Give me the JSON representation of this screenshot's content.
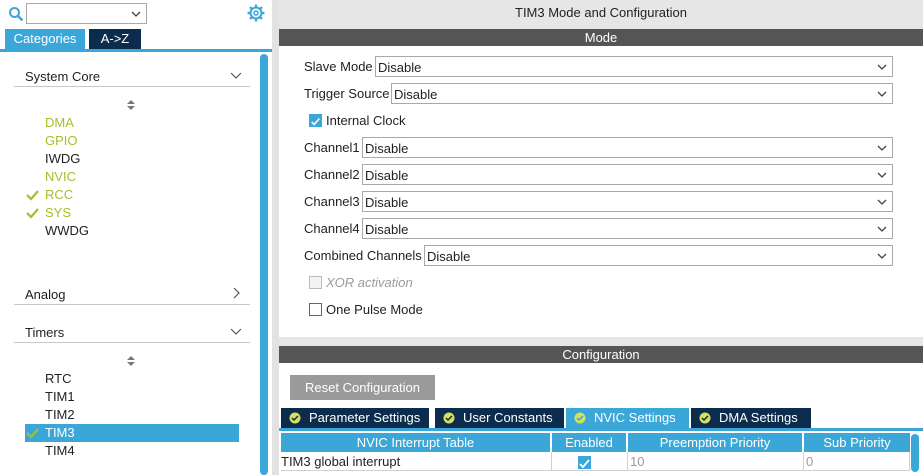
{
  "left_panel": {
    "tabs": {
      "categories": "Categories",
      "az": "A->Z"
    },
    "sections": {
      "system_core": {
        "title": "System Core",
        "items": [
          {
            "label": "DMA",
            "color": "#a7be2a",
            "checked": false
          },
          {
            "label": "GPIO",
            "color": "#a7be2a",
            "checked": false
          },
          {
            "label": "IWDG",
            "color": "#222222",
            "checked": false
          },
          {
            "label": "NVIC",
            "color": "#a7be2a",
            "checked": false
          },
          {
            "label": "RCC",
            "color": "#a7be2a",
            "checked": true
          },
          {
            "label": "SYS",
            "color": "#a7be2a",
            "checked": true
          },
          {
            "label": "WWDG",
            "color": "#222222",
            "checked": false
          }
        ]
      },
      "analog": {
        "title": "Analog"
      },
      "timers": {
        "title": "Timers",
        "items": [
          {
            "label": "RTC",
            "checked": false,
            "selected": false
          },
          {
            "label": "TIM1",
            "checked": false,
            "selected": false
          },
          {
            "label": "TIM2",
            "checked": false,
            "selected": false
          },
          {
            "label": "TIM3",
            "checked": true,
            "selected": true
          },
          {
            "label": "TIM4",
            "checked": false,
            "selected": false
          }
        ]
      }
    }
  },
  "right_panel": {
    "title": "TIM3 Mode and Configuration",
    "mode": {
      "header": "Mode",
      "slave_mode": {
        "label": "Slave Mode",
        "value": "Disable"
      },
      "trigger_source": {
        "label": "Trigger Source",
        "value": "Disable"
      },
      "internal_clock": {
        "label": "Internal Clock",
        "checked": true
      },
      "channel1": {
        "label": "Channel1",
        "value": "Disable"
      },
      "channel2": {
        "label": "Channel2",
        "value": "Disable"
      },
      "channel3": {
        "label": "Channel3",
        "value": "Disable"
      },
      "channel4": {
        "label": "Channel4",
        "value": "Disable"
      },
      "combined_channels": {
        "label": "Combined Channels",
        "value": "Disable"
      },
      "xor_activation": {
        "label": "XOR activation",
        "checked": false,
        "disabled": true
      },
      "one_pulse_mode": {
        "label": "One Pulse Mode",
        "checked": false
      }
    },
    "configuration": {
      "header": "Configuration",
      "reset_button": "Reset Configuration",
      "tabs": [
        {
          "label": "Parameter Settings",
          "active": false
        },
        {
          "label": "User Constants",
          "active": false
        },
        {
          "label": "NVIC Settings",
          "active": true
        },
        {
          "label": "DMA Settings",
          "active": false
        }
      ],
      "table": {
        "columns": [
          "NVIC Interrupt Table",
          "Enabled",
          "Preemption Priority",
          "Sub Priority"
        ],
        "rows": [
          {
            "name": "TIM3 global interrupt",
            "enabled": true,
            "preemption": "10",
            "sub": "0"
          }
        ]
      }
    }
  },
  "colors": {
    "accent": "#3ba7d9",
    "dark_tab": "#0c2c4d",
    "bar_header": "#555555",
    "green_item": "#a7be2a",
    "check_green": "#a7be2a"
  }
}
